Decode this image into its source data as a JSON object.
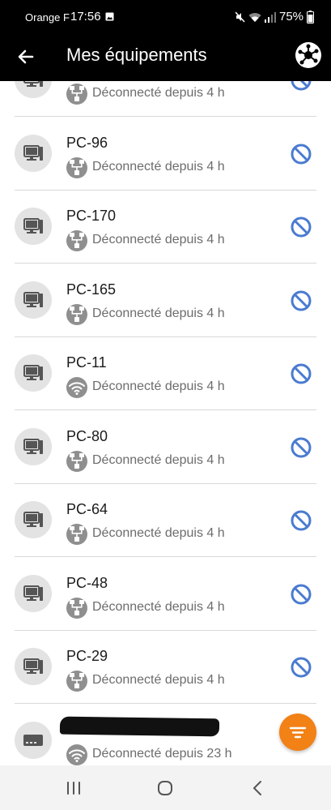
{
  "status_bar": {
    "carrier": "Orange F",
    "time": "17:56",
    "battery": "75%"
  },
  "header": {
    "title": "Mes équipements"
  },
  "devices": [
    {
      "name": "",
      "status": "Déconnecté depuis 4 h",
      "connection": "ethernet",
      "device_icon": "desktop-pc-icon",
      "partial": true
    },
    {
      "name": "PC-96",
      "status": "Déconnecté depuis 4 h",
      "connection": "ethernet",
      "device_icon": "desktop-pc-icon"
    },
    {
      "name": "PC-170",
      "status": "Déconnecté depuis 4 h",
      "connection": "ethernet",
      "device_icon": "desktop-pc-icon"
    },
    {
      "name": "PC-165",
      "status": "Déconnecté depuis 4 h",
      "connection": "ethernet",
      "device_icon": "desktop-pc-icon"
    },
    {
      "name": "PC-11",
      "status": "Déconnecté depuis 4 h",
      "connection": "wifi",
      "device_icon": "desktop-pc-icon"
    },
    {
      "name": "PC-80",
      "status": "Déconnecté depuis 4 h",
      "connection": "ethernet",
      "device_icon": "desktop-pc-icon"
    },
    {
      "name": "PC-64",
      "status": "Déconnecté depuis 4 h",
      "connection": "ethernet",
      "device_icon": "desktop-pc-icon"
    },
    {
      "name": "PC-48",
      "status": "Déconnecté depuis 4 h",
      "connection": "ethernet",
      "device_icon": "desktop-pc-icon"
    },
    {
      "name": "PC-29",
      "status": "Déconnecté depuis 4 h",
      "connection": "ethernet",
      "device_icon": "desktop-pc-icon"
    },
    {
      "name": "",
      "status": "Déconnecté depuis 23 h",
      "connection": "wifi",
      "device_icon": "tv-box-icon",
      "name_redacted": true
    }
  ],
  "colors": {
    "app_bar": "#000000",
    "block_icon": "#4a7bd0",
    "fab": "#f28116",
    "status_text": "#6c6c6c",
    "connection_badge": "#8f8f8f"
  },
  "icons": {
    "back": "arrow-left-icon",
    "hub": "network-hub-icon",
    "block": "block-icon",
    "fab": "sort-filter-icon",
    "nav_recents": "recent-apps-icon",
    "nav_home": "home-icon",
    "nav_back": "chevron-left-icon"
  }
}
